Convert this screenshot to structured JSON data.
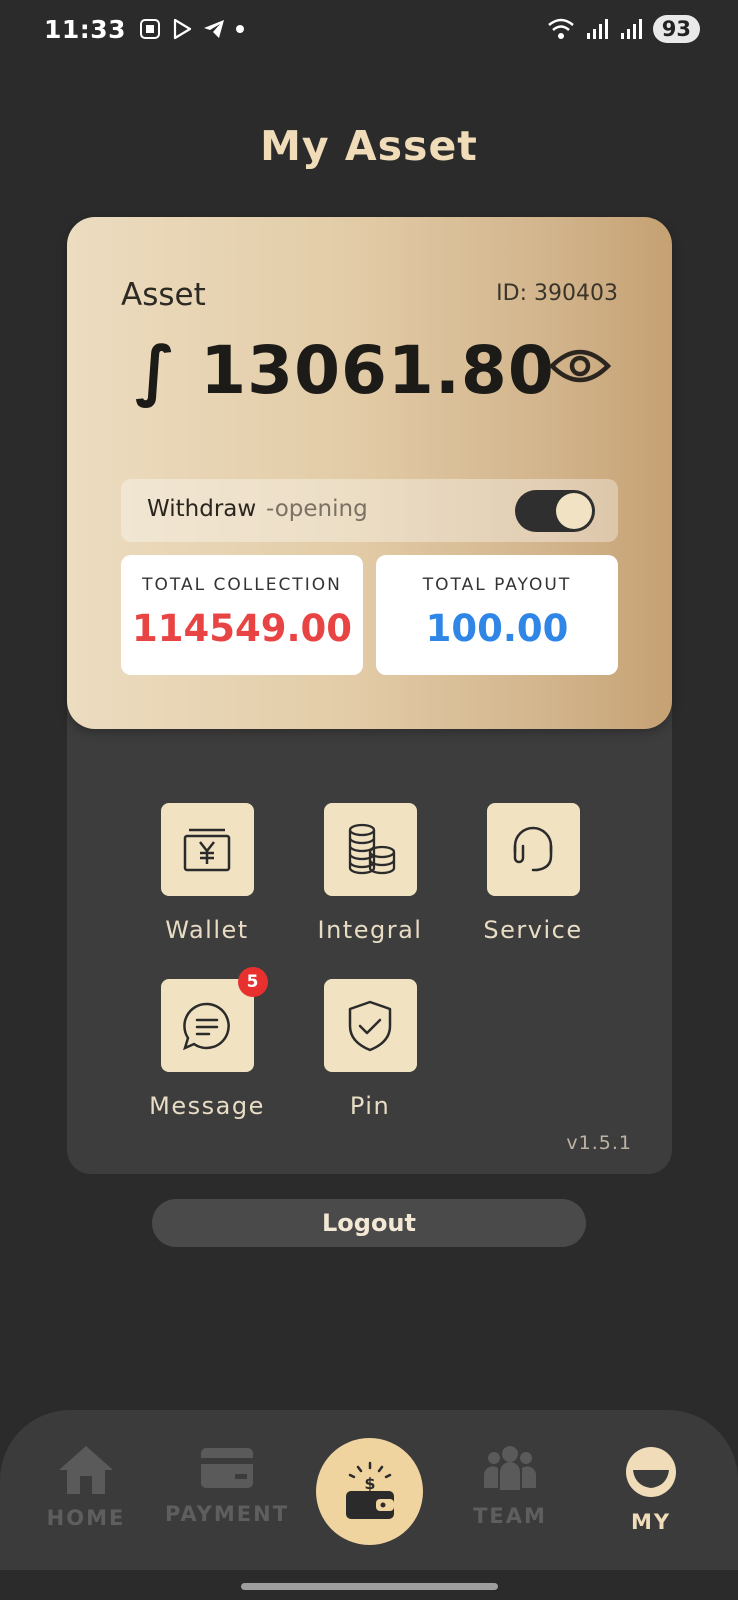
{
  "status_bar": {
    "time": "11:33",
    "battery": "93"
  },
  "page": {
    "title": "My Asset"
  },
  "asset_card": {
    "label": "Asset",
    "id_text": "ID: 390403",
    "amount": "∫ 13061.80",
    "withdraw_label": "Withdraw",
    "withdraw_status": "-opening",
    "withdraw_enabled": true,
    "total_collection_label": "TOTAL COLLECTION",
    "total_collection_value": "114549.00",
    "total_payout_label": "TOTAL PAYOUT",
    "total_payout_value": "100.00"
  },
  "menu": {
    "items": [
      {
        "label": "Wallet",
        "icon": "wallet-yen-icon"
      },
      {
        "label": "Integral",
        "icon": "coins-icon"
      },
      {
        "label": "Service",
        "icon": "headset-icon"
      },
      {
        "label": "Message",
        "icon": "chat-icon",
        "badge": "5"
      },
      {
        "label": "Pin",
        "icon": "shield-check-icon"
      }
    ],
    "version": "v1.5.1"
  },
  "logout": {
    "label": "Logout"
  },
  "bottom_nav": {
    "items": [
      {
        "label": "HOME",
        "icon": "home-icon"
      },
      {
        "label": "PAYMENT",
        "icon": "card-icon"
      },
      {
        "label": "",
        "icon": "wallet-money-icon"
      },
      {
        "label": "TEAM",
        "icon": "team-icon"
      },
      {
        "label": "MY",
        "icon": "profile-icon",
        "active": true
      }
    ]
  },
  "colors": {
    "background": "#2b2b2b",
    "accent_gold": "#f0d49f",
    "collection_red": "#e94444",
    "payout_blue": "#2f86e6",
    "badge_red": "#e8312f"
  }
}
